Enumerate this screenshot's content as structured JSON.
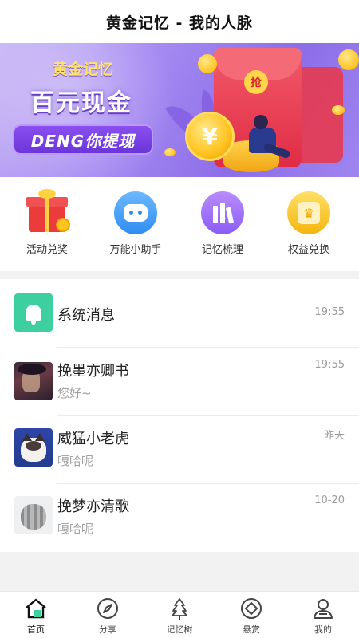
{
  "header": {
    "title": "黄金记忆 - 我的人脉"
  },
  "banner": {
    "subtitle": "黄金记忆",
    "headline": "百元现金",
    "cta": "DENG你提现",
    "envelope_tag": "抢",
    "coin_symbol": "¥"
  },
  "quick_actions": [
    {
      "label": "活动兑奖",
      "icon": "gift-icon"
    },
    {
      "label": "万能小助手",
      "icon": "robot-icon"
    },
    {
      "label": "记忆梳理",
      "icon": "books-icon"
    },
    {
      "label": "权益兑换",
      "icon": "crown-badge-icon"
    }
  ],
  "messages": [
    {
      "name": "系统消息",
      "preview": "",
      "time": "19:55",
      "avatar": "bell-icon"
    },
    {
      "name": "挽墨亦卿书",
      "preview": "您好~",
      "time": "19:55",
      "avatar": "warrior-avatar"
    },
    {
      "name": "威猛小老虎",
      "preview": "嘎哈呢",
      "time": "昨天",
      "avatar": "cat-avatar"
    },
    {
      "name": "挽梦亦清歌",
      "preview": "嘎哈呢",
      "time": "10-20",
      "avatar": "kitten-avatar"
    }
  ],
  "bottom_nav": [
    {
      "label": "首页",
      "icon": "home-icon",
      "active": true
    },
    {
      "label": "分享",
      "icon": "compass-icon",
      "active": false
    },
    {
      "label": "记忆树",
      "icon": "tree-icon",
      "active": false
    },
    {
      "label": "悬赏",
      "icon": "reward-icon",
      "active": false
    },
    {
      "label": "我的",
      "icon": "profile-icon",
      "active": false
    }
  ],
  "colors": {
    "banner_purple": "#8d6de8",
    "system_green": "#3ecfa0",
    "robot_blue": "#2f8df2",
    "books_purple": "#8b5cf6",
    "badge_gold": "#f5c518",
    "active_nav_accent": "#3ecfa0"
  }
}
